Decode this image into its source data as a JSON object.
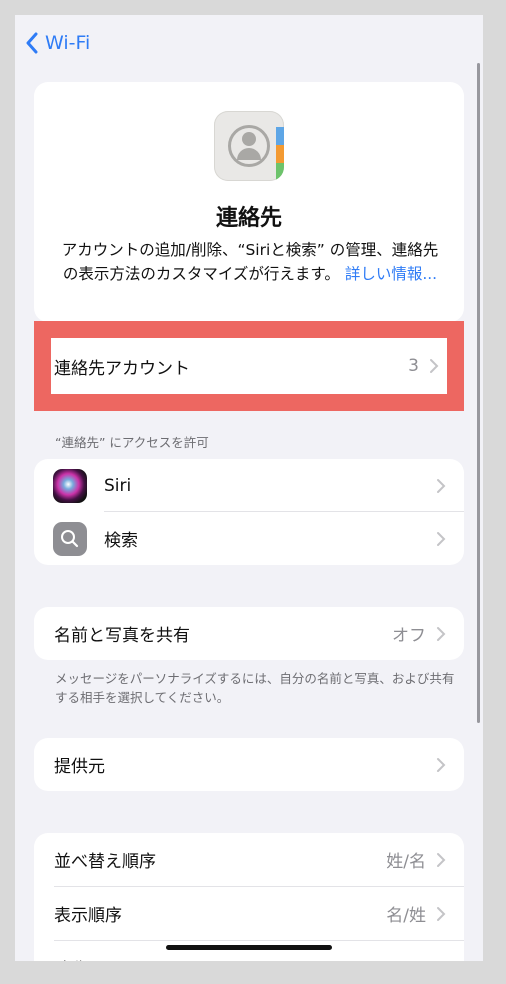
{
  "nav": {
    "back_label": "Wi-Fi"
  },
  "header": {
    "title": "連絡先",
    "description": "アカウントの追加/削除、“Siriと検索” の管理、連絡先の表示方法のカスタマイズが行えます。",
    "link": "詳しい情報..."
  },
  "accounts_row": {
    "label": "連絡先アカウント",
    "value": "3"
  },
  "access_section": {
    "caption": "“連絡先” にアクセスを許可",
    "items": [
      {
        "label": "Siri",
        "icon": "siri-icon"
      },
      {
        "label": "検索",
        "icon": "search-icon"
      }
    ]
  },
  "share_row": {
    "label": "名前と写真を共有",
    "value": "オフ"
  },
  "share_note": "メッセージをパーソナライズするには、自分の名前と写真、および共有する相手を選択してください。",
  "provider_row": {
    "label": "提供元"
  },
  "display_section": {
    "items": [
      {
        "label": "並べ替え順序",
        "value": "姓/名"
      },
      {
        "label": "表示順序",
        "value": "名/姓"
      },
      {
        "label": "略称"
      }
    ]
  },
  "colors": {
    "accent": "#2f7cf6",
    "highlight": "#ed6761",
    "background": "#f2f2f7"
  }
}
